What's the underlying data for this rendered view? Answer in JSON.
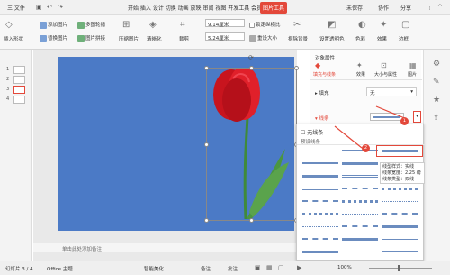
{
  "menubar": {
    "file": "三 文件",
    "tabs": "开始 插入 设计 切换 动画 放映 审阅 视图 开发工具 会员专享",
    "picture_tools": "图片工具",
    "sync": "未保存",
    "collab": "协作",
    "share": "分享"
  },
  "ribbon": {
    "insert_shape": "插入形状",
    "add_picture": "添加图片",
    "replace_picture": "替换图片",
    "multi_crop": "多图轮播",
    "picture_splice": "图片拼接",
    "compress": "压缩图片",
    "clarity": "清晰化",
    "crop": "裁剪",
    "height": "9.14厘米",
    "width": "5.24厘米",
    "lock_ratio": "锁定纵横比",
    "reset_size": "重设大小",
    "cutout": "抠除背景",
    "transparent": "设置透明色",
    "color": "色彩",
    "effects": "效果",
    "border": "边框"
  },
  "slides": [
    "1",
    "2",
    "3",
    "4"
  ],
  "notes_placeholder": "单击此处添加备注",
  "statusbar": {
    "slide_count": "幻灯片 3 / 4",
    "theme": "Office 主题",
    "smart_beautify": "智能美化",
    "notes": "备注",
    "comments": "批注",
    "zoom": "100%"
  },
  "properties": {
    "title": "对象属性",
    "tabs": [
      "填充与线条",
      "效果",
      "大小与属性",
      "图片"
    ],
    "fill_label": "填充",
    "fill_value": "无",
    "line_label": "线条"
  },
  "dropdown": {
    "no_line": "无线条",
    "preset_label": "预设线条",
    "tooltip": [
      "线型样式：实线",
      "线条宽度：2.25 磅",
      "线条类型：双线"
    ]
  },
  "badges": [
    "1",
    "2"
  ],
  "colors": {
    "accent": "#e3483a",
    "slide_bg": "#4b7ac6",
    "line_blue": "#6b8cbf"
  }
}
